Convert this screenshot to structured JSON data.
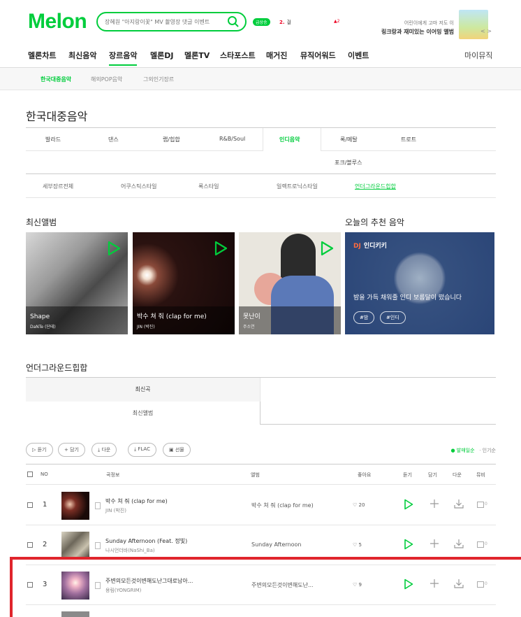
{
  "header": {
    "logo": "Melon",
    "search_placeholder": "장혜원 \"아지랑이꽃\" MV 촬영장 댓글 이벤트",
    "badge": "급상승",
    "rank_num": "2.",
    "rank_text": "걸",
    "rank_change": "2",
    "promo_line1": "어린이에게 고마 저도 이",
    "promo_line2": "링크랑과 재미있는 이어밍 앨범",
    "promo_nav": "< >"
  },
  "gnb": {
    "items": [
      "멜론차트",
      "최신음악",
      "장르음악",
      "멜론DJ",
      "멜론TV",
      "스타포스트",
      "매거진",
      "뮤직어워드",
      "이벤트"
    ],
    "my": "마이뮤직"
  },
  "subnav": {
    "items": [
      "한국대중음악",
      "해외POP음악",
      "그외인기장르"
    ]
  },
  "page_title": "한국대중음악",
  "genres": {
    "row1": [
      "발라드",
      "댄스",
      "랩/힙합",
      "R&B/Soul",
      "인디음악",
      "록/메탈",
      "트로트"
    ],
    "row2": [
      "포크/블루스"
    ],
    "row3": [
      "세부장르전체",
      "어쿠스틱스타일",
      "록스타일",
      "일렉트로닉스타일",
      "언더그라운드힙합"
    ]
  },
  "sections": {
    "latest": "최신앨범",
    "today": "오늘의 추천 음악",
    "underground": "언더그라운드힙합"
  },
  "albums": [
    {
      "title": "Shape",
      "artist": "DaNTe (단테)"
    },
    {
      "title": "박수 쳐 줘 (clap for me)",
      "artist": "JIN (박진)"
    },
    {
      "title": "못난이",
      "artist": "주소연"
    }
  ],
  "recommend": {
    "dj_label": "DJ",
    "dj_name": "인디키키",
    "desc": "밤을 가득 채워줄 인디 보름달이 떴습니다",
    "tags": [
      "#밤",
      "#인디"
    ]
  },
  "tabs": {
    "tab1": "최신곡",
    "tab2": "최신앨범"
  },
  "actions": {
    "buttons": [
      "듣기",
      "담기",
      "다운",
      "FLAC",
      "선물"
    ],
    "sort_active": "● 발매일순",
    "sort_other": "· 인기순"
  },
  "table": {
    "headers": [
      "NO",
      "곡정보",
      "앨범",
      "좋아요",
      "듣기",
      "담기",
      "다운",
      "뮤비"
    ],
    "rows": [
      {
        "no": "1",
        "song": "박수 쳐 줘 (clap for me)",
        "artist": "JIN (박진)",
        "album": "박수 쳐 줘 (clap for me)",
        "likes": "20",
        "mv": "0"
      },
      {
        "no": "2",
        "song": "Sunday Afternoon (Feat. 정빛)",
        "artist": "나시언더바(NaShi_Ba)",
        "album": "Sunday Afternoon",
        "likes": "5",
        "mv": "0"
      },
      {
        "no": "3",
        "song": "주변의모든것이변해도난그대로남아...",
        "artist": "용림(YONGRIM)",
        "album": "주변의모든것이변해도난...",
        "likes": "9",
        "mv": "0"
      }
    ]
  },
  "colors": {
    "brand": "#00cd3c",
    "highlight": "#e0252c"
  }
}
